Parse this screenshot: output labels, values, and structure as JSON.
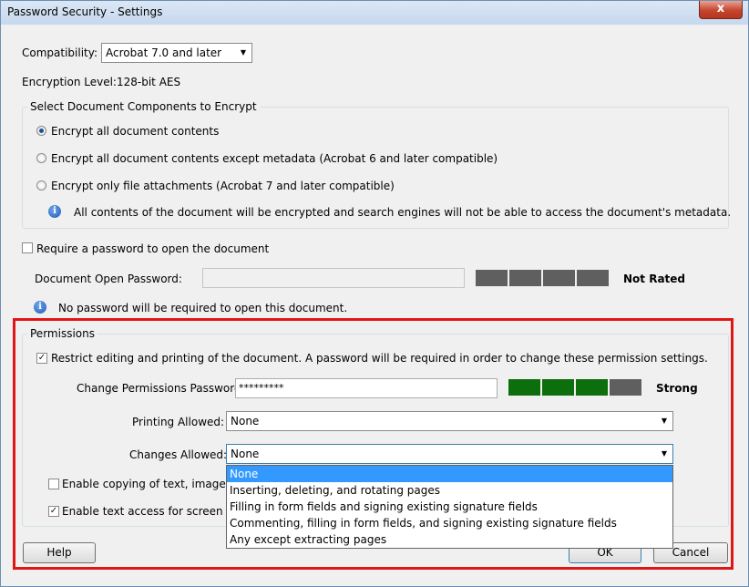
{
  "window": {
    "title": "Password Security - Settings",
    "close_glyph": "x"
  },
  "compatibility": {
    "label": "Compatibility:",
    "value": "Acrobat 7.0 and later"
  },
  "encryption": {
    "label": "Encryption  Level:",
    "value": "128-bit AES"
  },
  "components": {
    "title": "Select Document Components to Encrypt",
    "options": [
      {
        "label": "Encrypt all document contents",
        "checked": true
      },
      {
        "label": "Encrypt all document contents except metadata (Acrobat 6 and later compatible)",
        "checked": false
      },
      {
        "label": "Encrypt only file attachments (Acrobat 7 and later compatible)",
        "checked": false
      }
    ],
    "info": "All contents of the document will be encrypted and search engines will not be able to access the document's metadata."
  },
  "open_password": {
    "require_label": "Require a password to open the document",
    "require_checked": false,
    "field_label": "Document Open Password:",
    "value": "",
    "rating": "Not Rated",
    "info": "No password will be required to open this document."
  },
  "permissions": {
    "title": "Permissions",
    "restrict_label": "Restrict editing and printing of the document. A password will be required in order to change these permission settings.",
    "restrict_checked": true,
    "password_label": "Change Permissions Password:",
    "password_value": "*********",
    "strength": "Strong",
    "strength_level": 0.8,
    "printing_label": "Printing Allowed:",
    "printing_value": "None",
    "changes_label": "Changes Allowed:",
    "changes_value": "None",
    "copy_label": "Enable copying of text, images, an",
    "copy_checked": false,
    "screen_reader_label": "Enable text access for screen reade",
    "screen_reader_checked": true
  },
  "changes_dropdown": {
    "options": [
      "None",
      "Inserting, deleting, and rotating pages",
      "Filling in form fields and signing existing signature fields",
      "Commenting, filling in form fields, and signing existing signature fields",
      "Any except extracting pages"
    ],
    "selected_index": 0
  },
  "buttons": {
    "help": "Help",
    "ok": "OK",
    "cancel": "Cancel"
  },
  "icons": {
    "info": "i",
    "check": "✓",
    "arrow": "▼"
  },
  "colors": {
    "highlight_border": "#e11515",
    "strong_meter": "#0d6e0d",
    "selection": "#3399ff"
  }
}
